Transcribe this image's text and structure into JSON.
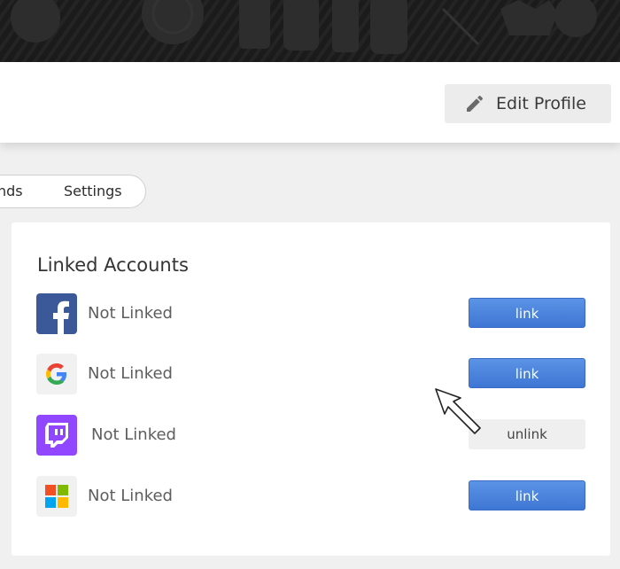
{
  "header": {
    "edit_profile_label": "Edit Profile",
    "accent": "#4a7fdc"
  },
  "tabs": [
    {
      "label": "nds"
    },
    {
      "label": "Settings"
    }
  ],
  "linked_accounts": {
    "title": "Linked Accounts",
    "accounts": [
      {
        "provider": "facebook",
        "icon": "facebook-icon",
        "status": "Not Linked",
        "action": "link",
        "brand_color": "#3b5998"
      },
      {
        "provider": "google",
        "icon": "google-icon",
        "status": "Not Linked",
        "action": "link",
        "brand_color": "#4285f4"
      },
      {
        "provider": "twitch",
        "icon": "twitch-icon",
        "status": "Not Linked",
        "action": "unlink",
        "brand_color": "#9146ff"
      },
      {
        "provider": "microsoft",
        "icon": "microsoft-icon",
        "status": "Not Linked",
        "action": "link",
        "brand_color": "#f25022"
      }
    ]
  }
}
